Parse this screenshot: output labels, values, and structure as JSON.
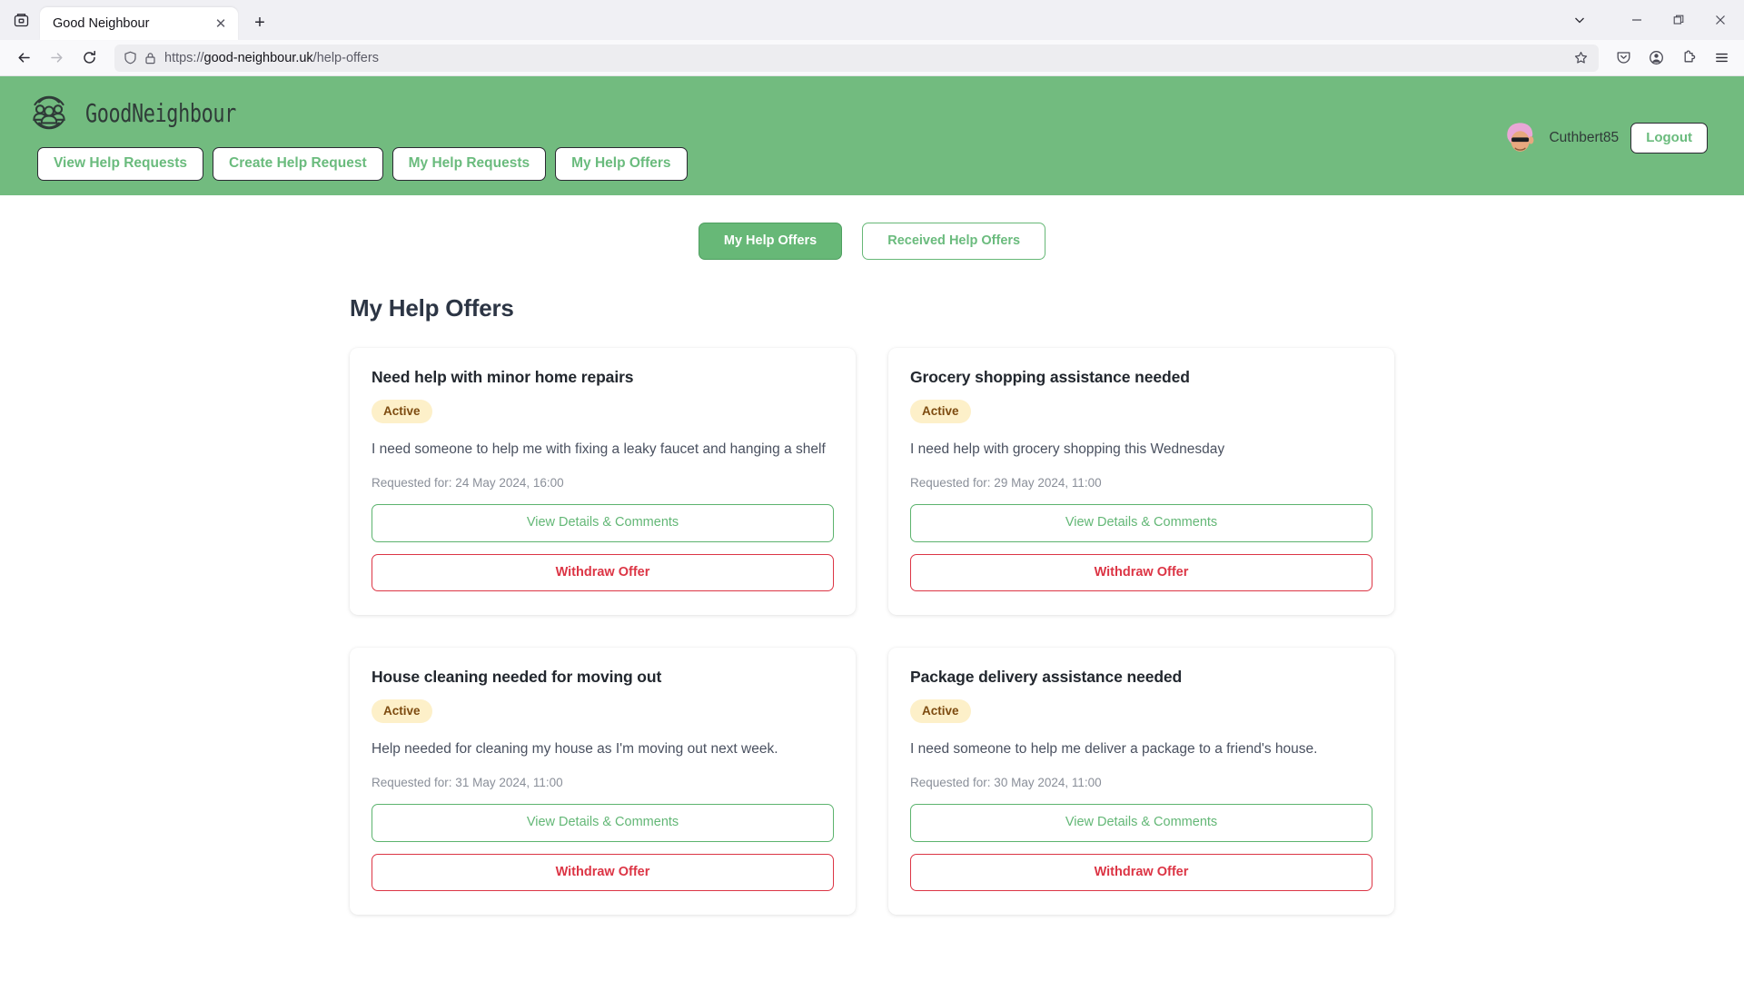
{
  "browser": {
    "tab_title": "Good Neighbour",
    "url_scheme": "https://",
    "url_domain": "good-neighbour.uk",
    "url_path": "/help-offers",
    "new_tab_label": "+",
    "close_tab_label": "✕"
  },
  "site": {
    "brand_name": "GoodNeighbour",
    "nav": [
      {
        "label": "View Help Requests"
      },
      {
        "label": "Create Help Request"
      },
      {
        "label": "My Help Requests"
      },
      {
        "label": "My Help Offers"
      }
    ],
    "username": "Cuthbert85",
    "logout_label": "Logout",
    "header_color": "#72bb7f"
  },
  "toggles": [
    {
      "label": "My Help Offers",
      "state": "active"
    },
    {
      "label": "Received Help Offers",
      "state": "inactive"
    }
  ],
  "main": {
    "page_title": "My Help Offers",
    "meta_prefix": "Requested for: ",
    "view_label": "View Details & Comments",
    "withdraw_label": "Withdraw Offer",
    "cards": [
      {
        "title": "Need help with minor home repairs",
        "status": "Active",
        "description": "I need someone to help me with fixing a leaky faucet and hanging a shelf",
        "requested_for": "Requested for: 24 May 2024, 16:00",
        "view_label": "View Details & Comments",
        "withdraw_label": "Withdraw Offer"
      },
      {
        "title": "Grocery shopping assistance needed",
        "status": "Active",
        "description": "I need help with grocery shopping this Wednesday",
        "requested_for": "Requested for: 29 May 2024, 11:00",
        "view_label": "View Details & Comments",
        "withdraw_label": "Withdraw Offer"
      },
      {
        "title": "House cleaning needed for moving out",
        "status": "Active",
        "description": "Help needed for cleaning my house as I'm moving out next week.",
        "requested_for": "Requested for: 31 May 2024, 11:00",
        "view_label": "View Details & Comments",
        "withdraw_label": "Withdraw Offer"
      },
      {
        "title": "Package delivery assistance needed",
        "status": "Active",
        "description": "I need someone to help me deliver a package to a friend's house.",
        "requested_for": "Requested for: 30 May 2024, 11:00",
        "view_label": "View Details & Comments",
        "withdraw_label": "Withdraw Offer"
      }
    ]
  },
  "colors": {
    "brand_green": "#72bb7f",
    "accent_green": "#67b877",
    "danger_red": "#dc3545",
    "badge_bg": "#fdf0c9",
    "badge_text": "#7d4b10"
  }
}
